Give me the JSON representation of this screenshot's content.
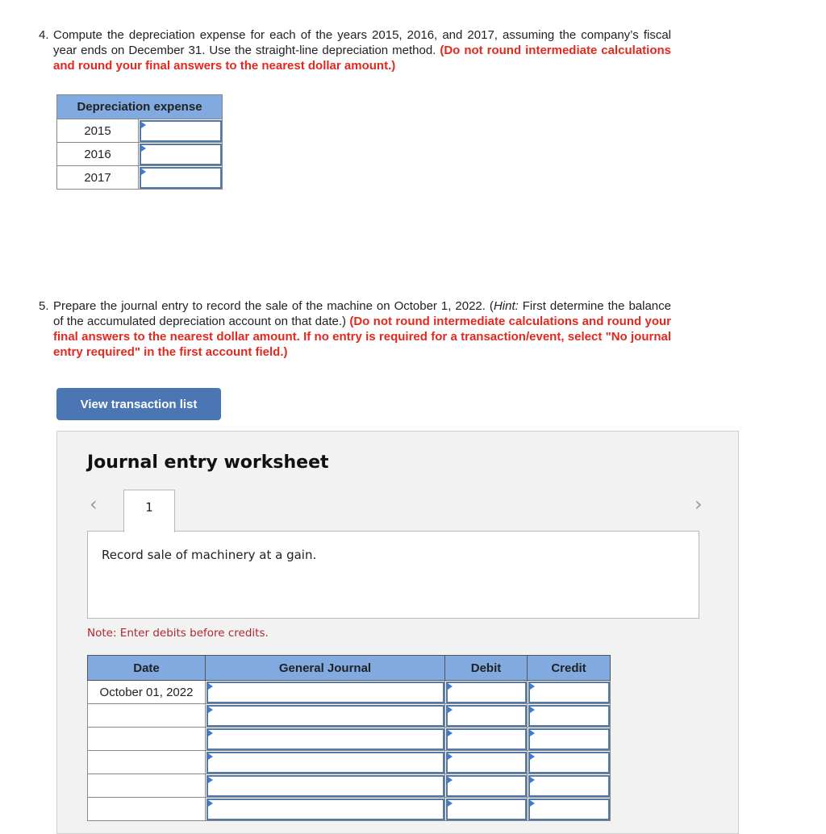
{
  "question4": {
    "number": "4.",
    "text": "Compute the depreciation expense for each of the years 2015, 2016, and 2017, assuming the company’s fiscal year ends on December 31. Use the straight-line depreciation method.",
    "instruction": "(Do not round intermediate calculations and round your final answers to the nearest dollar amount.)"
  },
  "depreciation_table": {
    "header": "Depreciation expense",
    "rows": [
      {
        "year": "2015",
        "value": ""
      },
      {
        "year": "2016",
        "value": ""
      },
      {
        "year": "2017",
        "value": ""
      }
    ]
  },
  "question5": {
    "number": "5.",
    "text_before_hint": "Prepare the journal entry to record the sale of the machine on October 1, 2022. (",
    "hint_label": "Hint:",
    "hint_text": " First determine the balance of the accumulated depreciation account on that date.)",
    "instruction": "(Do not round intermediate calculations and round your final answers to the nearest dollar amount. If no entry is required for a transaction/event, select \"No journal entry required\" in the first account field.)"
  },
  "view_transaction_button": "View transaction list",
  "worksheet": {
    "title": "Journal entry worksheet",
    "prev_icon": "‹",
    "next_icon": "›",
    "tabs": [
      "1"
    ],
    "description": "Record sale of machinery at a gain.",
    "note": "Note: Enter debits before credits.",
    "columns": [
      "Date",
      "General Journal",
      "Debit",
      "Credit"
    ],
    "rows": [
      {
        "date": "October 01, 2022",
        "account": "",
        "debit": "",
        "credit": ""
      },
      {
        "date": "",
        "account": "",
        "debit": "",
        "credit": ""
      },
      {
        "date": "",
        "account": "",
        "debit": "",
        "credit": ""
      },
      {
        "date": "",
        "account": "",
        "debit": "",
        "credit": ""
      },
      {
        "date": "",
        "account": "",
        "debit": "",
        "credit": ""
      },
      {
        "date": "",
        "account": "",
        "debit": "",
        "credit": ""
      }
    ]
  },
  "colors": {
    "header_blue": "#80aae0",
    "button_blue": "#4a77b4",
    "instruction_red": "#e3281e",
    "note_red": "#b0282c",
    "input_border": "#5379a9"
  }
}
